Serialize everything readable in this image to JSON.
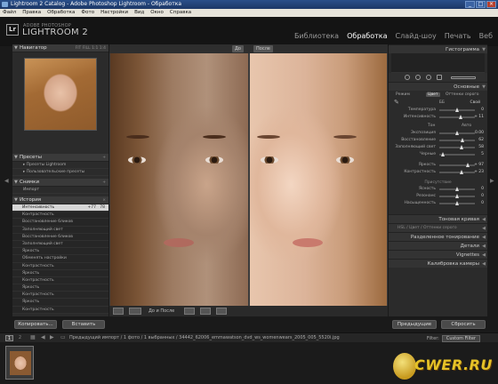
{
  "window": {
    "title": "Lightroom 2 Catalog - Adobe Photoshop Lightroom - Обработка"
  },
  "menu": [
    "Файл",
    "Правка",
    "Обработка",
    "Фото",
    "Настройки",
    "Вид",
    "Окно",
    "Справка"
  ],
  "brand": {
    "logo": "Lr",
    "small": "ADOBE PHOTOSHOP",
    "big": "LIGHTROOM 2"
  },
  "modules": [
    {
      "label": "Библиотека",
      "active": false
    },
    {
      "label": "Обработка",
      "active": true
    },
    {
      "label": "Слайд-шоу",
      "active": false
    },
    {
      "label": "Печать",
      "active": false
    },
    {
      "label": "Веб",
      "active": false
    }
  ],
  "left": {
    "navigator": {
      "title": "Навигатор",
      "opts": "FIT  FILL  1:1  1:4"
    },
    "presets": {
      "title": "Пресеты",
      "items": [
        "Пресеты Lightroom",
        "Пользовательские пресеты"
      ]
    },
    "snapshots": {
      "title": "Снимки",
      "items": [
        "Импорт"
      ]
    },
    "history": {
      "title": "История",
      "rows": [
        {
          "label": "Интенсивность",
          "v": "+77",
          "v2": "78",
          "selected": true
        },
        {
          "label": "Контрастность",
          "v": "",
          "v2": "",
          "selected": false
        },
        {
          "label": "Восстановление бликов",
          "v": "",
          "v2": "",
          "selected": false
        },
        {
          "label": "Заполняющий свет",
          "v": "",
          "v2": "",
          "selected": false
        },
        {
          "label": "Восстановление бликов",
          "v": "",
          "v2": "",
          "selected": false
        },
        {
          "label": "Заполняющий свет",
          "v": "",
          "v2": "",
          "selected": false
        },
        {
          "label": "Яркость",
          "v": "",
          "v2": "",
          "selected": false
        },
        {
          "label": "Обменять настройки",
          "v": "",
          "v2": "",
          "selected": false
        },
        {
          "label": "Контрастность",
          "v": "",
          "v2": "",
          "selected": false
        },
        {
          "label": "Яркость",
          "v": "",
          "v2": "",
          "selected": false
        },
        {
          "label": "Контрастность",
          "v": "",
          "v2": "",
          "selected": false
        },
        {
          "label": "Яркость",
          "v": "",
          "v2": "",
          "selected": false
        },
        {
          "label": "Контрастность",
          "v": "",
          "v2": "",
          "selected": false
        },
        {
          "label": "Яркость",
          "v": "",
          "v2": "",
          "selected": false
        },
        {
          "label": "Контрастность",
          "v": "",
          "v2": "",
          "selected": false
        }
      ]
    },
    "copy_label": "Копировать...",
    "paste_label": "Вставить"
  },
  "center": {
    "before_label": "До",
    "after_label": "После",
    "toolbar_text": "До и После"
  },
  "right": {
    "histogram": {
      "title": "Гистограмма"
    },
    "basic": {
      "title": "Основные",
      "mode_tabs": [
        "Режим",
        "Цвет",
        "Оттенки серого"
      ],
      "wb_label": "ББ",
      "wb_value": "Свой",
      "temp": {
        "label": "Температура",
        "value": "0"
      },
      "tint": {
        "label": "Интенсивность",
        "value": "+ 11"
      },
      "tone_label": "Тон",
      "auto_label": "Авто",
      "tone_rows": [
        {
          "label": "Экспозиция",
          "value": "0.00"
        },
        {
          "label": "Восстановление",
          "value": "62"
        },
        {
          "label": "Заполняющий свет",
          "value": "58"
        },
        {
          "label": "Черные",
          "value": "5"
        },
        {
          "label": "Яркость",
          "value": "+ 97"
        },
        {
          "label": "Контрастность",
          "value": "+ 23"
        }
      ],
      "presence_label": "Присутствие",
      "presence_rows": [
        {
          "label": "Ясность",
          "value": "0"
        },
        {
          "label": "Резонанс",
          "value": "0"
        },
        {
          "label": "Насыщенность",
          "value": "0"
        }
      ]
    },
    "sections": [
      {
        "label": "Тоновая кривая",
        "left": ""
      },
      {
        "label": "",
        "left": "HSL  /  Цвет  /  Оттенки серого"
      },
      {
        "label": "Разделенное тонирование",
        "left": ""
      },
      {
        "label": "Детали",
        "left": ""
      },
      {
        "label": "Vignettes",
        "left": ""
      },
      {
        "label": "Калибровка камеры",
        "left": ""
      }
    ],
    "prev_label": "Предыдущие",
    "reset_label": "Сбросить"
  },
  "filmbar": {
    "nums": [
      "1",
      "2"
    ],
    "path": "Предыдущий импорт / 1 фото / 1 выбранных / 34442_62006_emmawatson_dvd_ws_womenwears_2005_005_5520i.jpg",
    "filter_label": "Filter:",
    "filter_value": "Custom Filter"
  },
  "watermark": "CWER.RU"
}
